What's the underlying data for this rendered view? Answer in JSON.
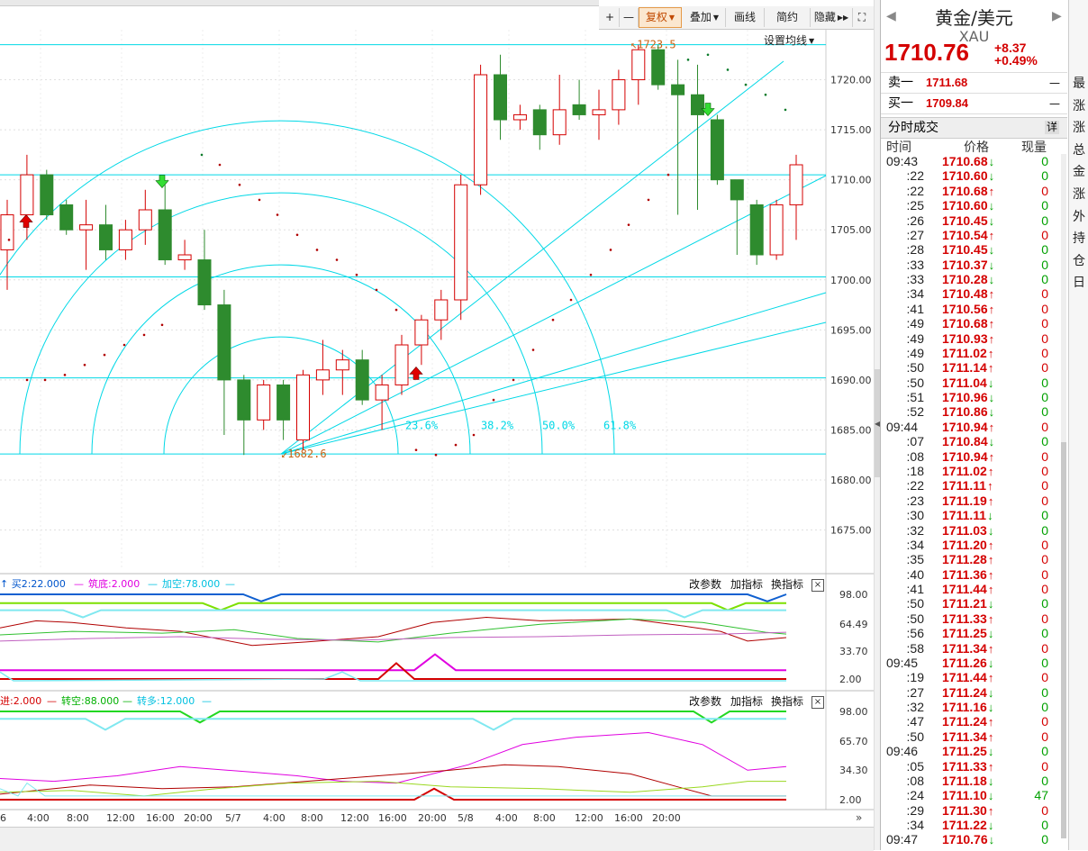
{
  "toolbar": {
    "plus": "+",
    "minus": "—",
    "restore_rights": "复权",
    "overlay": "叠加",
    "draw": "画线",
    "simple": "简约",
    "hide": "隐藏",
    "expand": "⛶"
  },
  "main_chart": {
    "settings_link": "设置均线",
    "y_ticks": [
      "1720.00",
      "1715.00",
      "1710.00",
      "1705.00",
      "1700.00",
      "1695.00",
      "1690.00",
      "1685.00",
      "1680.00",
      "1675.00"
    ],
    "high_label": "1723.5",
    "low_label": "1682.6",
    "fib_labels": [
      "23.6%",
      "38.2%",
      "50.0%",
      "61.8%"
    ]
  },
  "chart_data": {
    "type": "candlestick",
    "ylim": [
      1671,
      1725
    ],
    "candles": [
      {
        "o": 1703.0,
        "h": 1708.0,
        "l": 1699.0,
        "c": 1706.5
      },
      {
        "o": 1706.5,
        "h": 1712.5,
        "l": 1704.0,
        "c": 1710.5
      },
      {
        "o": 1710.5,
        "h": 1711.0,
        "l": 1706.0,
        "c": 1706.5
      },
      {
        "o": 1707.5,
        "h": 1708.0,
        "l": 1704.5,
        "c": 1705.0
      },
      {
        "o": 1705.0,
        "h": 1708.0,
        "l": 1701.0,
        "c": 1705.5
      },
      {
        "o": 1705.5,
        "h": 1707.5,
        "l": 1702.0,
        "c": 1703.0
      },
      {
        "o": 1703.0,
        "h": 1706.0,
        "l": 1702.0,
        "c": 1705.0
      },
      {
        "o": 1705.0,
        "h": 1709.0,
        "l": 1703.5,
        "c": 1707.0
      },
      {
        "o": 1707.0,
        "h": 1709.5,
        "l": 1701.5,
        "c": 1702.0
      },
      {
        "o": 1702.0,
        "h": 1704.0,
        "l": 1701.0,
        "c": 1702.5
      },
      {
        "o": 1702.0,
        "h": 1705.0,
        "l": 1697.0,
        "c": 1697.5
      },
      {
        "o": 1697.5,
        "h": 1699.0,
        "l": 1684.5,
        "c": 1690.0
      },
      {
        "o": 1690.0,
        "h": 1690.5,
        "l": 1682.5,
        "c": 1686.0
      },
      {
        "o": 1686.0,
        "h": 1690.0,
        "l": 1685.0,
        "c": 1689.5
      },
      {
        "o": 1689.5,
        "h": 1690.0,
        "l": 1684.0,
        "c": 1686.0
      },
      {
        "o": 1684.0,
        "h": 1691.0,
        "l": 1683.0,
        "c": 1690.5
      },
      {
        "o": 1690.0,
        "h": 1694.0,
        "l": 1688.5,
        "c": 1691.0
      },
      {
        "o": 1691.0,
        "h": 1693.0,
        "l": 1688.5,
        "c": 1692.0
      },
      {
        "o": 1692.0,
        "h": 1693.0,
        "l": 1687.5,
        "c": 1688.0
      },
      {
        "o": 1688.0,
        "h": 1690.5,
        "l": 1685.0,
        "c": 1689.5
      },
      {
        "o": 1689.5,
        "h": 1694.5,
        "l": 1688.5,
        "c": 1693.5
      },
      {
        "o": 1693.5,
        "h": 1696.5,
        "l": 1691.5,
        "c": 1696.0
      },
      {
        "o": 1696.0,
        "h": 1699.0,
        "l": 1694.0,
        "c": 1698.0
      },
      {
        "o": 1698.0,
        "h": 1710.5,
        "l": 1696.0,
        "c": 1709.5
      },
      {
        "o": 1709.5,
        "h": 1721.5,
        "l": 1708.5,
        "c": 1720.5
      },
      {
        "o": 1720.5,
        "h": 1722.5,
        "l": 1714.0,
        "c": 1716.0
      },
      {
        "o": 1716.0,
        "h": 1717.5,
        "l": 1715.0,
        "c": 1716.5
      },
      {
        "o": 1717.0,
        "h": 1717.5,
        "l": 1713.0,
        "c": 1714.5
      },
      {
        "o": 1714.5,
        "h": 1720.5,
        "l": 1713.5,
        "c": 1717.0
      },
      {
        "o": 1717.5,
        "h": 1720.0,
        "l": 1716.0,
        "c": 1716.5
      },
      {
        "o": 1716.5,
        "h": 1719.0,
        "l": 1714.0,
        "c": 1717.0
      },
      {
        "o": 1717.0,
        "h": 1721.0,
        "l": 1715.5,
        "c": 1720.0
      },
      {
        "o": 1720.0,
        "h": 1723.5,
        "l": 1717.5,
        "c": 1723.0
      },
      {
        "o": 1723.0,
        "h": 1723.5,
        "l": 1719.0,
        "c": 1719.5
      },
      {
        "o": 1719.5,
        "h": 1722.0,
        "l": 1706.5,
        "c": 1718.5
      },
      {
        "o": 1718.5,
        "h": 1721.5,
        "l": 1707.0,
        "c": 1716.5
      },
      {
        "o": 1716.0,
        "h": 1716.5,
        "l": 1709.5,
        "c": 1710.0
      },
      {
        "o": 1710.0,
        "h": 1710.0,
        "l": 1702.5,
        "c": 1708.0
      },
      {
        "o": 1707.5,
        "h": 1708.0,
        "l": 1701.5,
        "c": 1702.5
      },
      {
        "o": 1702.5,
        "h": 1708.0,
        "l": 1702.0,
        "c": 1707.5
      },
      {
        "o": 1707.5,
        "h": 1712.5,
        "l": 1704.0,
        "c": 1711.5
      }
    ]
  },
  "sub1": {
    "params": [
      "↑ 买2:22.000",
      "—",
      "筑底:2.000",
      "—",
      "加空:78.000",
      "—"
    ],
    "buttons": [
      "改参数",
      "加指标",
      "换指标"
    ],
    "y_ticks": [
      "98.00",
      "64.49",
      "33.70",
      "2.00"
    ]
  },
  "sub2": {
    "params": [
      "进:2.000",
      "—",
      "转空:88.000",
      "—",
      "转多:12.000",
      "—"
    ],
    "buttons": [
      "改参数",
      "加指标",
      "换指标"
    ],
    "y_ticks": [
      "98.00",
      "65.70",
      "34.30",
      "2.00"
    ]
  },
  "x_axis": [
    "6",
    "4:00",
    "8:00",
    "12:00",
    "16:00",
    "20:00",
    "5/7",
    "4:00",
    "8:00",
    "12:00",
    "16:00",
    "20:00",
    "5/8",
    "4:00",
    "8:00",
    "12:00",
    "16:00",
    "20:00"
  ],
  "quote": {
    "title": "黄金/美元",
    "code": "XAU",
    "price": "1710.76",
    "change": "+8.37",
    "change_pct": "+0.49%",
    "sell_label": "卖一",
    "sell_price": "1711.68",
    "buy_label": "买一",
    "buy_price": "1709.84",
    "dash": "—",
    "ticks_title": "分时成交",
    "ticks_detail": "详",
    "col_time": "时间",
    "col_price": "价格",
    "col_vol": "现量"
  },
  "ticks": [
    {
      "t": "09:43",
      "p": "1710.68",
      "d": "dn",
      "v": "0"
    },
    {
      "t": ":22",
      "p": "1710.60",
      "d": "dn",
      "v": "0"
    },
    {
      "t": ":22",
      "p": "1710.68",
      "d": "up",
      "v": "0"
    },
    {
      "t": ":25",
      "p": "1710.60",
      "d": "dn",
      "v": "0"
    },
    {
      "t": ":26",
      "p": "1710.45",
      "d": "dn",
      "v": "0"
    },
    {
      "t": ":27",
      "p": "1710.54",
      "d": "up",
      "v": "0"
    },
    {
      "t": ":28",
      "p": "1710.45",
      "d": "dn",
      "v": "0"
    },
    {
      "t": ":33",
      "p": "1710.37",
      "d": "dn",
      "v": "0"
    },
    {
      "t": ":33",
      "p": "1710.28",
      "d": "dn",
      "v": "0"
    },
    {
      "t": ":34",
      "p": "1710.48",
      "d": "up",
      "v": "0"
    },
    {
      "t": ":41",
      "p": "1710.56",
      "d": "up",
      "v": "0"
    },
    {
      "t": ":49",
      "p": "1710.68",
      "d": "up",
      "v": "0"
    },
    {
      "t": ":49",
      "p": "1710.93",
      "d": "up",
      "v": "0"
    },
    {
      "t": ":49",
      "p": "1711.02",
      "d": "up",
      "v": "0"
    },
    {
      "t": ":50",
      "p": "1711.14",
      "d": "up",
      "v": "0"
    },
    {
      "t": ":50",
      "p": "1711.04",
      "d": "dn",
      "v": "0"
    },
    {
      "t": ":51",
      "p": "1710.96",
      "d": "dn",
      "v": "0"
    },
    {
      "t": ":52",
      "p": "1710.86",
      "d": "dn",
      "v": "0"
    },
    {
      "t": "09:44",
      "p": "1710.94",
      "d": "up",
      "v": "0"
    },
    {
      "t": ":07",
      "p": "1710.84",
      "d": "dn",
      "v": "0"
    },
    {
      "t": ":08",
      "p": "1710.94",
      "d": "up",
      "v": "0"
    },
    {
      "t": ":18",
      "p": "1711.02",
      "d": "up",
      "v": "0"
    },
    {
      "t": ":22",
      "p": "1711.11",
      "d": "up",
      "v": "0"
    },
    {
      "t": ":23",
      "p": "1711.19",
      "d": "up",
      "v": "0"
    },
    {
      "t": ":30",
      "p": "1711.11",
      "d": "dn",
      "v": "0"
    },
    {
      "t": ":32",
      "p": "1711.03",
      "d": "dn",
      "v": "0"
    },
    {
      "t": ":34",
      "p": "1711.20",
      "d": "up",
      "v": "0"
    },
    {
      "t": ":35",
      "p": "1711.28",
      "d": "up",
      "v": "0"
    },
    {
      "t": ":40",
      "p": "1711.36",
      "d": "up",
      "v": "0"
    },
    {
      "t": ":41",
      "p": "1711.44",
      "d": "up",
      "v": "0"
    },
    {
      "t": ":50",
      "p": "1711.21",
      "d": "dn",
      "v": "0"
    },
    {
      "t": ":50",
      "p": "1711.33",
      "d": "up",
      "v": "0"
    },
    {
      "t": ":56",
      "p": "1711.25",
      "d": "dn",
      "v": "0"
    },
    {
      "t": ":58",
      "p": "1711.34",
      "d": "up",
      "v": "0"
    },
    {
      "t": "09:45",
      "p": "1711.26",
      "d": "dn",
      "v": "0"
    },
    {
      "t": ":19",
      "p": "1711.44",
      "d": "up",
      "v": "0"
    },
    {
      "t": ":27",
      "p": "1711.24",
      "d": "dn",
      "v": "0"
    },
    {
      "t": ":32",
      "p": "1711.16",
      "d": "dn",
      "v": "0"
    },
    {
      "t": ":47",
      "p": "1711.24",
      "d": "up",
      "v": "0"
    },
    {
      "t": ":50",
      "p": "1711.34",
      "d": "up",
      "v": "0"
    },
    {
      "t": "09:46",
      "p": "1711.25",
      "d": "dn",
      "v": "0"
    },
    {
      "t": ":05",
      "p": "1711.33",
      "d": "up",
      "v": "0"
    },
    {
      "t": ":08",
      "p": "1711.18",
      "d": "dn",
      "v": "0"
    },
    {
      "t": ":24",
      "p": "1711.10",
      "d": "dn",
      "v": "47"
    },
    {
      "t": ":29",
      "p": "1711.30",
      "d": "up",
      "v": "0"
    },
    {
      "t": ":34",
      "p": "1711.22",
      "d": "dn",
      "v": "0"
    },
    {
      "t": "09:47",
      "p": "1710.76",
      "d": "dn",
      "v": "0"
    }
  ],
  "far_right": {
    "labels": [
      "最",
      "涨",
      "涨",
      "总",
      "金",
      "涨",
      "外",
      "持",
      "仓",
      "日"
    ]
  },
  "colors": {
    "up_candle": "#d40000",
    "down_candle": "#2e8b2e",
    "fib": "#00d8e6",
    "accent": "#e59a48"
  }
}
